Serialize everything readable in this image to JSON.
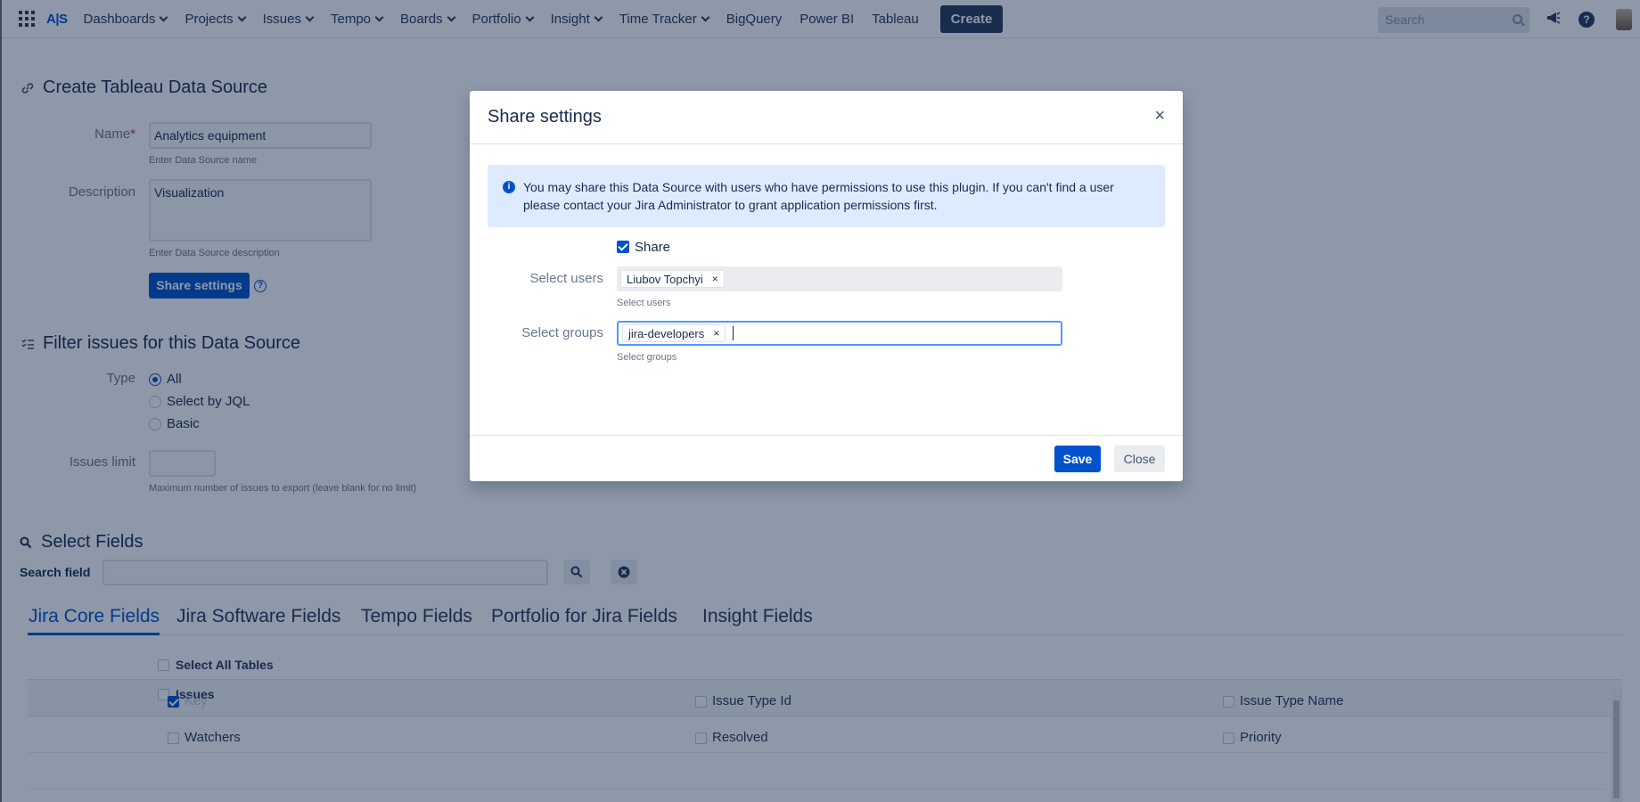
{
  "topnav": {
    "logo": "A|S",
    "items": [
      {
        "label": "Dashboards",
        "dropdown": true
      },
      {
        "label": "Projects",
        "dropdown": true
      },
      {
        "label": "Issues",
        "dropdown": true
      },
      {
        "label": "Tempo",
        "dropdown": true
      },
      {
        "label": "Boards",
        "dropdown": true
      },
      {
        "label": "Portfolio",
        "dropdown": true
      },
      {
        "label": "Insight",
        "dropdown": true
      },
      {
        "label": "Time Tracker",
        "dropdown": true
      },
      {
        "label": "BigQuery",
        "dropdown": false
      },
      {
        "label": "Power BI",
        "dropdown": false
      },
      {
        "label": "Tableau",
        "dropdown": false
      }
    ],
    "create_label": "Create",
    "search_placeholder": "Search",
    "help_glyph": "?"
  },
  "datasource": {
    "title": "Create Tableau Data Source",
    "name_label": "Name",
    "name_required": "*",
    "name_value": "Analytics equipment",
    "name_hint": "Enter Data Source name",
    "description_label": "Description",
    "description_value": "Visualization",
    "description_hint": "Enter Data Source description",
    "share_button": "Share settings",
    "help_glyph": "?"
  },
  "filter": {
    "title": "Filter issues for this Data Source",
    "type_label": "Type",
    "options": [
      {
        "label": "All",
        "selected": true
      },
      {
        "label": "Select by JQL",
        "selected": false
      },
      {
        "label": "Basic",
        "selected": false
      }
    ],
    "limit_label": "Issues limit",
    "limit_value": "",
    "limit_hint": "Maximum number of issues to export (leave blank for no limit)"
  },
  "fields": {
    "title": "Select Fields",
    "search_label": "Search field",
    "search_value": "",
    "tabs": [
      {
        "label": "Jira Core Fields",
        "active": true
      },
      {
        "label": "Jira Software Fields",
        "active": false
      },
      {
        "label": "Tempo Fields",
        "active": false
      },
      {
        "label": "Portfolio for Jira Fields",
        "active": false
      },
      {
        "label": "Insight Fields",
        "active": false
      }
    ],
    "select_all": "Select All Tables",
    "table_name": "Issues",
    "rows": [
      [
        {
          "label": "Key",
          "checked": true,
          "disabled": true
        },
        {
          "label": "Issue Type Id",
          "checked": false
        },
        {
          "label": "Issue Type Name",
          "checked": false
        }
      ],
      [
        {
          "label": "Watchers",
          "checked": false
        },
        {
          "label": "Resolved",
          "checked": false
        },
        {
          "label": "Priority",
          "checked": false
        }
      ]
    ]
  },
  "dialog": {
    "title": "Share settings",
    "close_glyph": "×",
    "info_icon_glyph": "i",
    "info_text": "You may share this Data Source with users who have permissions to use this plugin. If you can't find a user please contact your Jira Administrator to grant application permissions first.",
    "share_label": "Share",
    "share_checked": true,
    "users_label": "Select users",
    "users_selected": [
      "Liubov Topchyi"
    ],
    "users_hint": "Select users",
    "groups_label": "Select groups",
    "groups_selected": [
      "jira-developers"
    ],
    "groups_hint": "Select groups",
    "chip_remove_glyph": "×",
    "save_label": "Save",
    "close_label": "Close"
  },
  "colors": {
    "primary": "#0052cc",
    "nav_dark": "#253858",
    "info_bg": "#deebff",
    "overlay": "rgba(9, 30, 66, 0.46)"
  }
}
